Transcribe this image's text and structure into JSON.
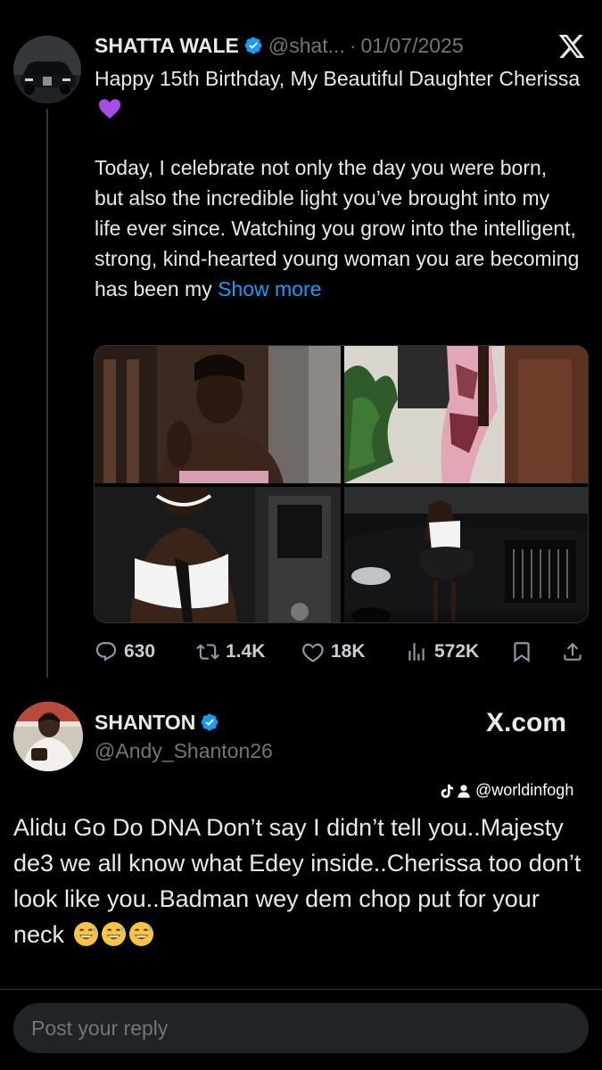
{
  "post": {
    "author_name": "SHATTA WALE",
    "handle": "@shat...",
    "separator": "·",
    "date": "01/07/2025",
    "text_line1": "Happy 15th Birthday, My Beautiful Daughter Cherissa",
    "text_emoji": "purple-heart",
    "text_paragraph": "Today, I celebrate not only the day you were born, but also the incredible light you’ve brought into my life ever since. Watching you grow into the intelligent, strong, kind-hearted young woman you are becoming has been my",
    "show_more": "Show more",
    "stats": {
      "replies": "630",
      "reposts": "1.4K",
      "likes": "18K",
      "views": "572K"
    }
  },
  "reply": {
    "author_name": "SHANTON",
    "handle": "@Andy_Shanton26",
    "site_label": "X.com",
    "watermark": "@worldinfogh",
    "text": "Alidu Go Do DNA Don’t say I didn’t tell you..Majesty de3 we all know what Edey inside..Cherissa too don’t look like you..Badman wey dem chop put for your neck",
    "emojis": [
      "grinning-sweat",
      "grinning-sweat",
      "grinning-sweat"
    ]
  },
  "compose": {
    "placeholder": "Post your reply"
  },
  "colors": {
    "background": "#000000",
    "accent_link": "#1d9bf0",
    "verified": "#1d9bf0",
    "muted": "#71767b",
    "compose_bg": "#202327"
  }
}
